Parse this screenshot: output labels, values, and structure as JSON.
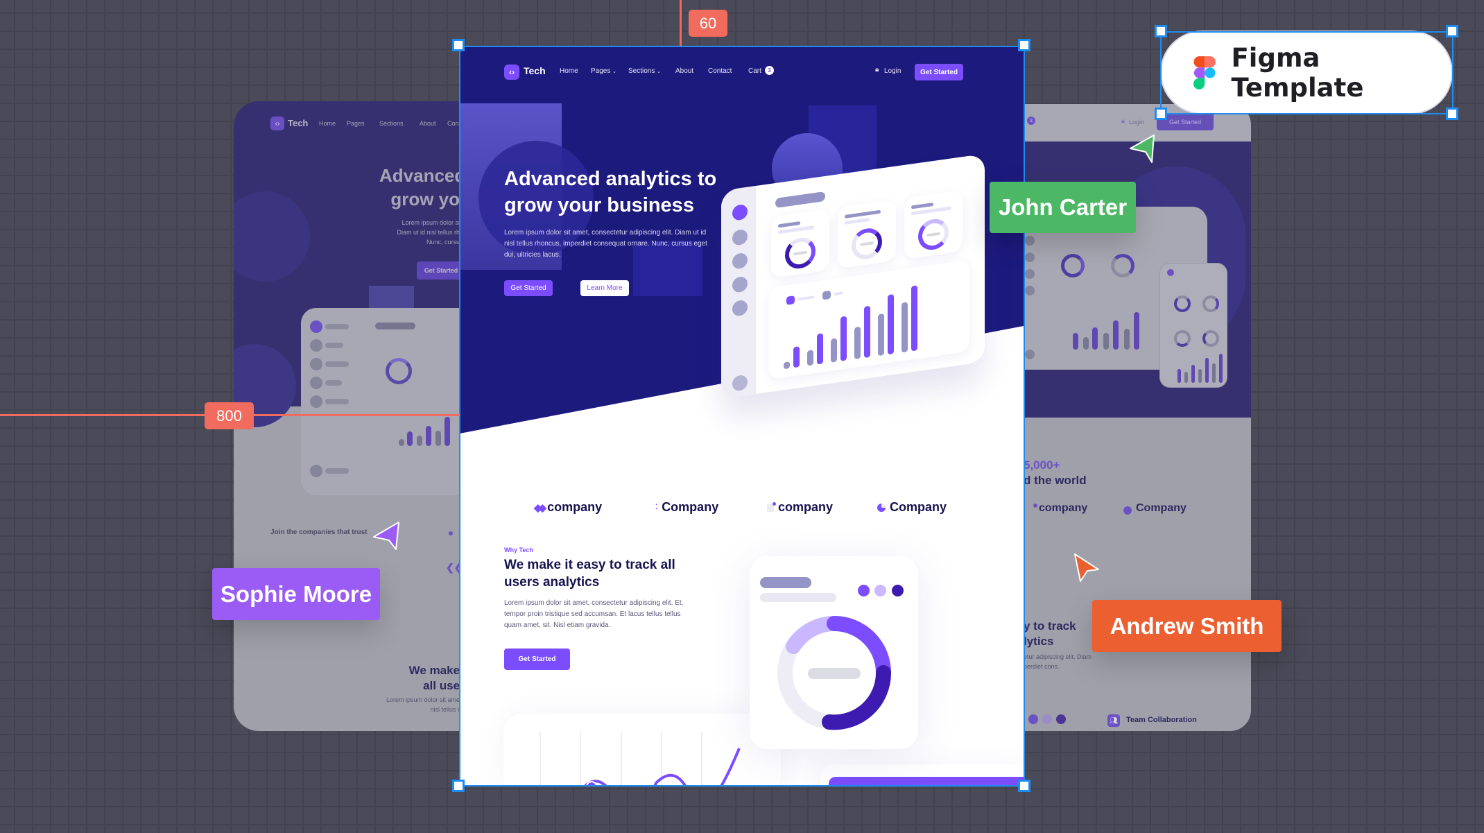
{
  "canvas": {
    "background": "#4a4a58"
  },
  "badge": {
    "label": "Figma Template",
    "icon": "figma-logo-icon"
  },
  "measurements": {
    "top_spacing": "60",
    "left_offset": "800"
  },
  "collaborators": [
    {
      "name": "John Carter",
      "color": "#4cb865"
    },
    {
      "name": "Sophie Moore",
      "color": "#9a5cf5"
    },
    {
      "name": "Andrew Smith",
      "color": "#ec5f31"
    }
  ],
  "site": {
    "brand": {
      "logo_icon": "code-brackets-icon",
      "name": "Tech"
    },
    "nav": {
      "items": [
        "Home",
        "Pages",
        "Sections",
        "About",
        "Contact",
        "Cart"
      ],
      "cart_count": "3",
      "login": "Login",
      "cta": "Get Started"
    },
    "hero": {
      "title": "Advanced analytics to grow your business",
      "body": "Lorem ipsum dolor sit amet, consectetur adipiscing elit. Diam ut id nisl tellus rhoncus, imperdiet consequat ornare. Nunc, cursus eget dui, ultricies lacus.",
      "primary_button": "Get Started",
      "secondary_button": "Learn More"
    },
    "companies": [
      "company",
      "Company",
      "company",
      "Company"
    ],
    "why": {
      "eyebrow": "Why Tech",
      "title": "We make it easy to track all users analytics",
      "body": "Lorem ipsum dolor sit amet, consectetur adipiscing elit. Et, tempor proin tristique sed accumsan. Et lacus tellus tellus quam amet, sit. Nisl etiam gravida.",
      "button": "Get Started"
    }
  },
  "left_preview": {
    "brand": "Tech",
    "nav": [
      "Home",
      "Pages",
      "Sections",
      "About",
      "Con"
    ],
    "hero_title_1": "Advanced",
    "hero_title_2": "grow yo",
    "hero_body": [
      "Lorem ipsum dolor si",
      "Diam ut id nisl tellus rh",
      "Nunc, cursu"
    ],
    "button": "Get Started",
    "trust_text": "Join the companies that trust",
    "sec_title_1": "We make",
    "sec_title_2": "all use",
    "sec_body": [
      "Lorem ipsum dolor sit ame",
      "nisl tellus r"
    ]
  },
  "right_preview": {
    "cart_count": "3",
    "login": "Login",
    "button": "Get Started",
    "stat": "5,000+",
    "stat_caption": "d the world",
    "companies": [
      "company",
      "Company"
    ],
    "sec_title_1": "y to track",
    "sec_title_2": "lytics",
    "sec_body": [
      "etur adipiscing elit. Diam",
      "perdiet cons."
    ],
    "feature": "Team Collaboration"
  }
}
